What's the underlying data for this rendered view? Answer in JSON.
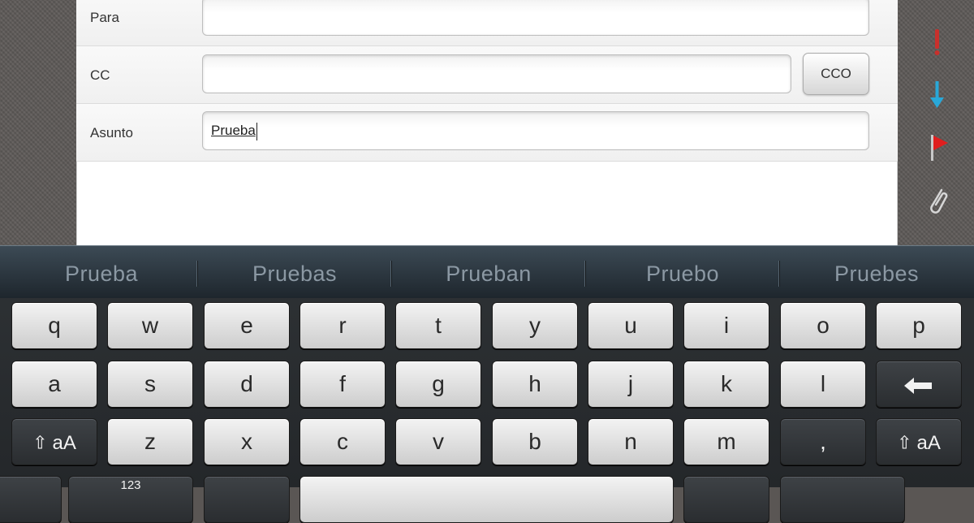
{
  "compose": {
    "to_label": "Para",
    "cc_label": "CC",
    "bcc_button": "CCO",
    "subject_label": "Asunto",
    "subject_value": "Prueba"
  },
  "sidebar_icons": [
    "priority-high-icon",
    "priority-low-icon",
    "flag-icon",
    "attachment-icon"
  ],
  "colors": {
    "priority_high": "#c9302c",
    "priority_low": "#29a8d8",
    "flag": "#e01e1e"
  },
  "keyboard": {
    "suggestions": [
      "Prueba",
      "Pruebas",
      "Prueban",
      "Pruebo",
      "Pruebes"
    ],
    "row1": [
      "q",
      "w",
      "e",
      "r",
      "t",
      "y",
      "u",
      "i",
      "o",
      "p"
    ],
    "row2": [
      "a",
      "s",
      "d",
      "f",
      "g",
      "h",
      "j",
      "k",
      "l"
    ],
    "row3": [
      "z",
      "x",
      "c",
      "v",
      "b",
      "n",
      "m",
      ","
    ],
    "shift_label": "aA",
    "numbers_label": "123"
  }
}
